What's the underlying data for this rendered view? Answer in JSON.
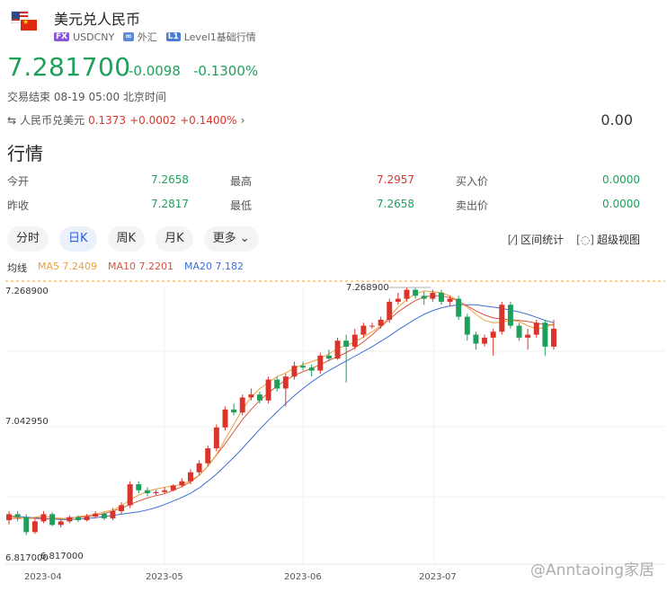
{
  "header": {
    "title": "美元兑人民币",
    "fx_tag": "FX",
    "code": "USDCNY",
    "market": "外汇",
    "level_tag": "L1",
    "level": "Level1基础行情"
  },
  "quote": {
    "price": "7.281700",
    "change": "-0.0098",
    "change_pct": "-0.1300%",
    "status": "交易结束 08-19 05:00 北京时间"
  },
  "cross": {
    "label": "人民币兑美元",
    "price": "0.1373",
    "change": "+0.0002",
    "change_pct": "+0.1400%",
    "right_value": "0.00"
  },
  "section_title": "行情",
  "stats": [
    {
      "l1": "今开",
      "v1": "7.2658",
      "l2": "最高",
      "v2": "7.2957",
      "l3": "买入价",
      "v3": "0.0000"
    },
    {
      "l1": "昨收",
      "v1": "7.2817",
      "l2": "最低",
      "v2": "7.2658",
      "l3": "卖出价",
      "v3": "0.0000"
    }
  ],
  "tabs": [
    "分时",
    "日K",
    "周K",
    "月K",
    "更多"
  ],
  "active_tab": "日K",
  "tools": {
    "range": "区间统计",
    "fullscreen": "超级视图"
  },
  "ma": {
    "label": "均线",
    "ma5": "MA5 7.2409",
    "ma10": "MA10 7.2201",
    "ma20": "MA20 7.182"
  },
  "watermark": "@Anntaoing家居",
  "colors": {
    "up": "#d9352b",
    "down": "#1ea05b",
    "ma5": "#e8a23a",
    "ma10": "#d95540",
    "ma20": "#3d6fd6"
  },
  "chart_data": {
    "type": "candlestick",
    "y_labels": [
      "7.268900",
      "7.042950",
      "6.817000"
    ],
    "max_label": "7.268900",
    "min_label": "6.817000",
    "x_labels": [
      "2023-04",
      "2023-05",
      "2023-06",
      "2023-07"
    ],
    "ylim": [
      6.817,
      7.2689
    ],
    "ma5": [
      6.886,
      6.885,
      6.882,
      6.885,
      6.887,
      6.884,
      6.883,
      6.882,
      6.886,
      6.888,
      6.89,
      6.894,
      6.897,
      6.904,
      6.914,
      6.922,
      6.928,
      6.932,
      6.935,
      6.937,
      6.94,
      6.946,
      6.955,
      6.97,
      6.99,
      7.015,
      7.04,
      7.065,
      7.085,
      7.1,
      7.11,
      7.12,
      7.126,
      7.134,
      7.14,
      7.145,
      7.15,
      7.158,
      7.167,
      7.172,
      7.178,
      7.186,
      7.195,
      7.205,
      7.22,
      7.236,
      7.249,
      7.258,
      7.263,
      7.262,
      7.26,
      7.255,
      7.246,
      7.236,
      7.224,
      7.214,
      7.21,
      7.211,
      7.214,
      7.212,
      7.205,
      7.2,
      7.202,
      7.208
    ],
    "ma10": [
      6.883,
      6.883,
      6.883,
      6.883,
      6.882,
      6.882,
      6.882,
      6.884,
      6.885,
      6.886,
      6.888,
      6.891,
      6.895,
      6.9,
      6.906,
      6.912,
      6.917,
      6.921,
      6.924,
      6.93,
      6.936,
      6.944,
      6.955,
      6.97,
      6.989,
      7.008,
      7.028,
      7.048,
      7.065,
      7.08,
      7.093,
      7.104,
      7.114,
      7.122,
      7.128,
      7.134,
      7.14,
      7.147,
      7.153,
      7.16,
      7.168,
      7.178,
      7.19,
      7.203,
      7.216,
      7.228,
      7.238,
      7.247,
      7.253,
      7.255,
      7.255,
      7.252,
      7.246,
      7.238,
      7.23,
      7.223,
      7.218,
      7.216,
      7.215,
      7.214,
      7.212,
      7.209,
      7.207,
      7.206
    ],
    "ma20": [
      6.887,
      6.886,
      6.885,
      6.884,
      6.883,
      6.882,
      6.881,
      6.881,
      6.882,
      6.883,
      6.884,
      6.886,
      6.888,
      6.89,
      6.892,
      6.894,
      6.897,
      6.901,
      6.906,
      6.912,
      6.918,
      6.925,
      6.934,
      6.945,
      6.957,
      6.971,
      6.985,
      7.0,
      7.016,
      7.032,
      7.047,
      7.061,
      7.075,
      7.088,
      7.1,
      7.111,
      7.121,
      7.13,
      7.138,
      7.146,
      7.154,
      7.162,
      7.17,
      7.179,
      7.188,
      7.198,
      7.207,
      7.216,
      7.224,
      7.23,
      7.235,
      7.238,
      7.24,
      7.24,
      7.24,
      7.238,
      7.236,
      7.234,
      7.231,
      7.228,
      7.224,
      7.219,
      7.214,
      7.21
    ],
    "candles": [
      [
        6.88,
        6.89,
        6.895,
        6.873
      ],
      [
        6.89,
        6.885,
        6.895,
        6.878
      ],
      [
        6.885,
        6.86,
        6.89,
        6.855
      ],
      [
        6.86,
        6.878,
        6.882,
        6.857
      ],
      [
        6.878,
        6.89,
        6.895,
        6.875
      ],
      [
        6.89,
        6.872,
        6.893,
        6.87
      ],
      [
        6.872,
        6.878,
        6.88,
        6.868
      ],
      [
        6.878,
        6.885,
        6.888,
        6.875
      ],
      [
        6.885,
        6.88,
        6.888,
        6.877
      ],
      [
        6.88,
        6.886,
        6.89,
        6.878
      ],
      [
        6.886,
        6.891,
        6.895,
        6.883
      ],
      [
        6.891,
        6.883,
        6.893,
        6.88
      ],
      [
        6.883,
        6.895,
        6.9,
        6.88
      ],
      [
        6.895,
        6.905,
        6.91,
        6.89
      ],
      [
        6.905,
        6.94,
        6.945,
        6.9
      ],
      [
        6.94,
        6.93,
        6.945,
        6.925
      ],
      [
        6.93,
        6.925,
        6.935,
        6.92
      ],
      [
        6.925,
        6.927,
        6.93,
        6.922
      ],
      [
        6.927,
        6.93,
        6.935,
        6.924
      ],
      [
        6.93,
        6.938,
        6.94,
        6.928
      ],
      [
        6.938,
        6.945,
        6.95,
        6.935
      ],
      [
        6.945,
        6.96,
        6.965,
        6.94
      ],
      [
        6.96,
        6.975,
        6.98,
        6.955
      ],
      [
        6.975,
        7.0,
        7.005,
        6.97
      ],
      [
        7.0,
        7.035,
        7.04,
        6.995
      ],
      [
        7.035,
        7.065,
        7.07,
        7.03
      ],
      [
        7.065,
        7.06,
        7.075,
        7.055
      ],
      [
        7.06,
        7.085,
        7.09,
        7.055
      ],
      [
        7.085,
        7.09,
        7.1,
        7.08
      ],
      [
        7.09,
        7.08,
        7.095,
        7.075
      ],
      [
        7.08,
        7.115,
        7.12,
        7.075
      ],
      [
        7.115,
        7.1,
        7.12,
        7.095
      ],
      [
        7.1,
        7.12,
        7.125,
        7.07
      ],
      [
        7.12,
        7.138,
        7.145,
        7.115
      ],
      [
        7.138,
        7.135,
        7.145,
        7.13
      ],
      [
        7.135,
        7.13,
        7.14,
        7.12
      ],
      [
        7.13,
        7.155,
        7.16,
        7.125
      ],
      [
        7.155,
        7.15,
        7.165,
        7.145
      ],
      [
        7.15,
        7.18,
        7.185,
        7.148
      ],
      [
        7.18,
        7.17,
        7.19,
        7.11
      ],
      [
        7.17,
        7.19,
        7.2,
        7.165
      ],
      [
        7.19,
        7.205,
        7.21,
        7.185
      ],
      [
        7.205,
        7.205,
        7.21,
        7.2
      ],
      [
        7.205,
        7.215,
        7.22,
        7.2
      ],
      [
        7.215,
        7.245,
        7.25,
        7.21
      ],
      [
        7.245,
        7.25,
        7.26,
        7.24
      ],
      [
        7.25,
        7.265,
        7.2689,
        7.245
      ],
      [
        7.265,
        7.255,
        7.268,
        7.25
      ],
      [
        7.255,
        7.25,
        7.262,
        7.24
      ],
      [
        7.25,
        7.26,
        7.265,
        7.245
      ],
      [
        7.26,
        7.245,
        7.265,
        7.24
      ],
      [
        7.245,
        7.25,
        7.255,
        7.238
      ],
      [
        7.25,
        7.22,
        7.255,
        7.215
      ],
      [
        7.22,
        7.19,
        7.225,
        7.18
      ],
      [
        7.19,
        7.175,
        7.195,
        7.165
      ],
      [
        7.175,
        7.185,
        7.19,
        7.17
      ],
      [
        7.185,
        7.195,
        7.2,
        7.155
      ],
      [
        7.195,
        7.24,
        7.245,
        7.19
      ],
      [
        7.24,
        7.205,
        7.245,
        7.2
      ],
      [
        7.205,
        7.185,
        7.21,
        7.18
      ],
      [
        7.185,
        7.19,
        7.2,
        7.165
      ],
      [
        7.19,
        7.21,
        7.215,
        7.185
      ],
      [
        7.21,
        7.17,
        7.215,
        7.155
      ],
      [
        7.17,
        7.2,
        7.215,
        7.165
      ]
    ]
  }
}
